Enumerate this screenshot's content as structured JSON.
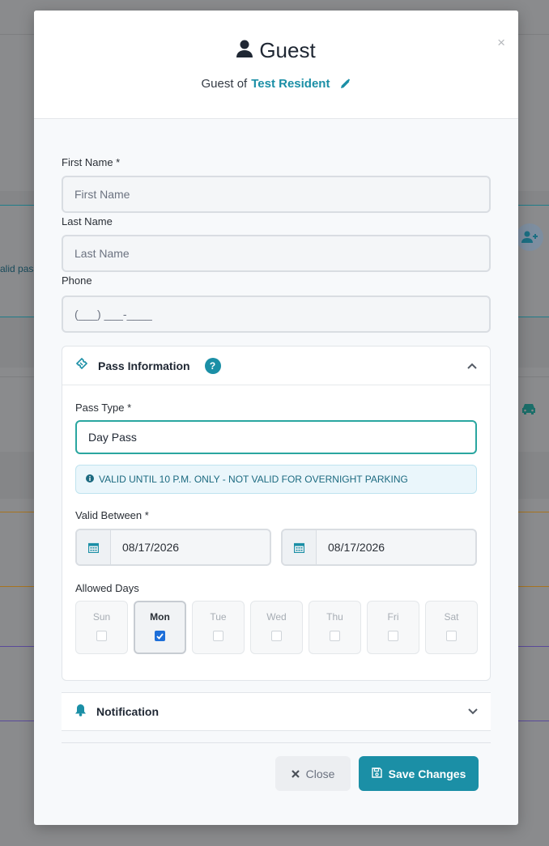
{
  "background": {
    "partial_text": "alid pass"
  },
  "modal": {
    "title": "Guest",
    "subtitle_prefix": "Guest of",
    "resident_name": "Test Resident",
    "close_glyph": "×"
  },
  "form": {
    "first_name": {
      "label": "First Name *",
      "placeholder": "First Name",
      "value": ""
    },
    "last_name": {
      "label": "Last Name",
      "placeholder": "Last Name",
      "value": ""
    },
    "phone": {
      "label": "Phone",
      "placeholder": "(___) ___-____",
      "value": ""
    }
  },
  "pass_info": {
    "title": "Pass Information",
    "help": "?",
    "pass_type_label": "Pass Type *",
    "pass_type_value": "Day Pass",
    "alert_text": "VALID UNTIL 10 P.M. ONLY - NOT VALID FOR OVERNIGHT PARKING",
    "valid_between_label": "Valid Between *",
    "start_date": "08/17/2026",
    "end_date": "08/17/2026",
    "allowed_days_label": "Allowed Days",
    "days": [
      {
        "name": "Sun",
        "checked": false
      },
      {
        "name": "Mon",
        "checked": true
      },
      {
        "name": "Tue",
        "checked": false
      },
      {
        "name": "Wed",
        "checked": false
      },
      {
        "name": "Thu",
        "checked": false
      },
      {
        "name": "Fri",
        "checked": false
      },
      {
        "name": "Sat",
        "checked": false
      }
    ]
  },
  "notification": {
    "title": "Notification"
  },
  "footer": {
    "close_label": "Close",
    "save_label": "Save Changes"
  },
  "colors": {
    "accent": "#1b8fa6",
    "select_border": "#2aa6a0",
    "checkbox": "#1e6fd9"
  },
  "icons": {
    "title": "user-icon",
    "edit": "pencil-icon",
    "pass": "ticket-icon",
    "date": "calendar-icon",
    "info": "info-circle-icon",
    "notification": "bell-icon",
    "close_btn": "times-icon",
    "save_btn": "floppy-disk-icon"
  }
}
